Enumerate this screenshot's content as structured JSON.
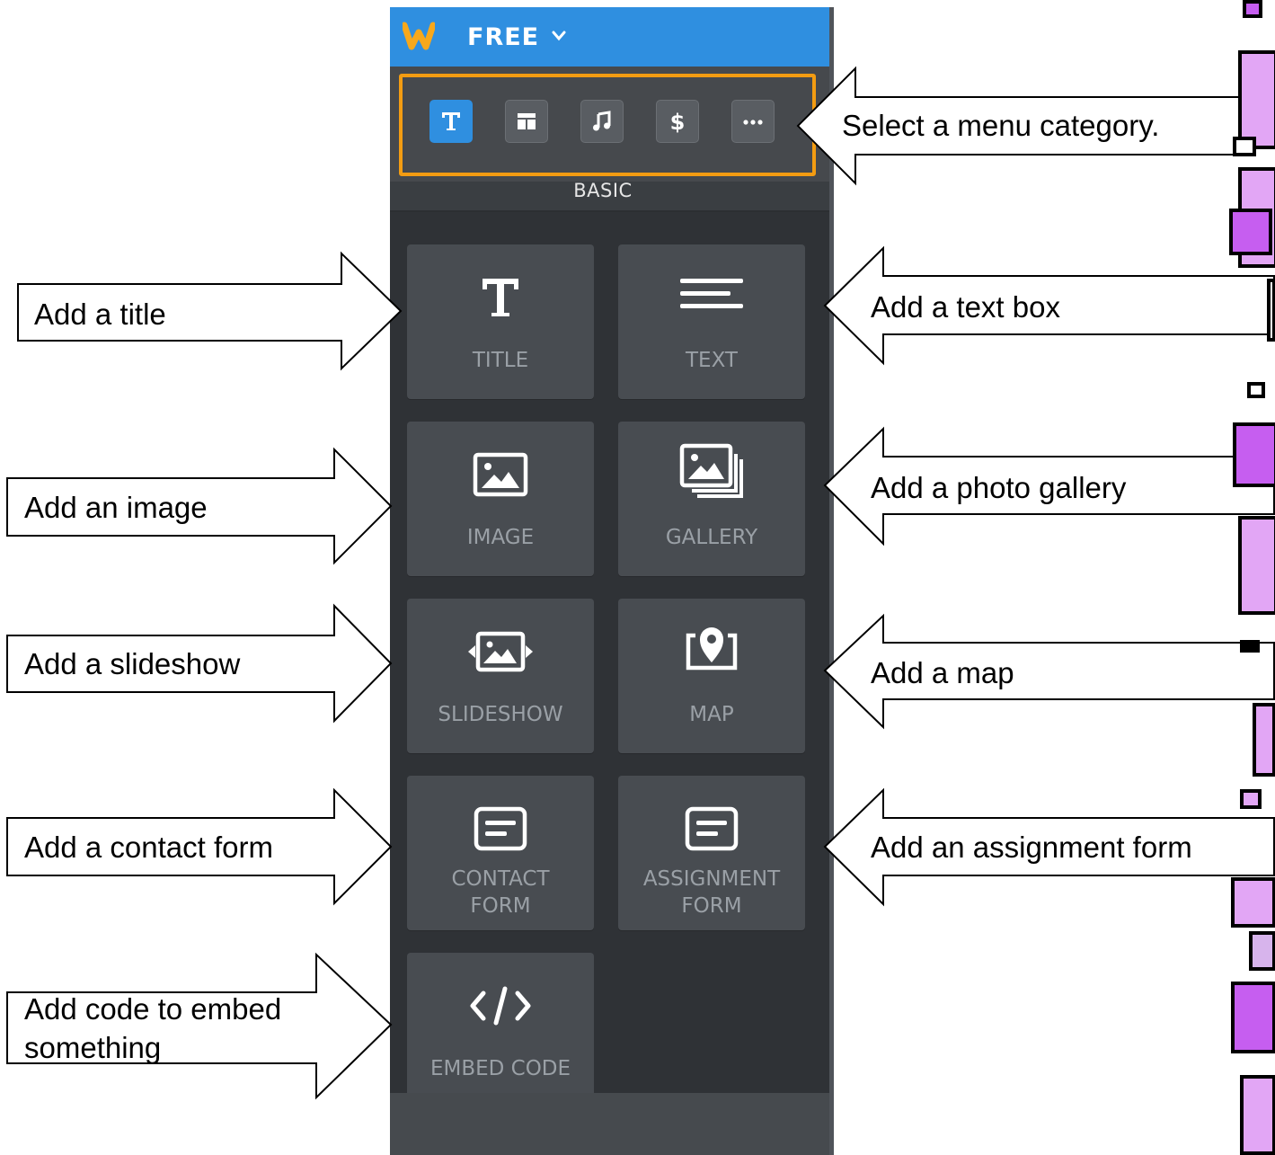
{
  "app": {
    "plan_label": "FREE"
  },
  "category_bar": {
    "buttons": [
      {
        "name": "text-category",
        "icon": "text-T-icon",
        "active": true
      },
      {
        "name": "layout-category",
        "icon": "layout-icon",
        "active": false
      },
      {
        "name": "media-category",
        "icon": "music-note-icon",
        "active": false
      },
      {
        "name": "commerce-category",
        "icon": "dollar-icon",
        "active": false
      },
      {
        "name": "more-category",
        "icon": "more-dots-icon",
        "active": false
      }
    ],
    "active_label": "BASIC",
    "highlight_color": "#f39c12",
    "active_color": "#2f8fe0"
  },
  "elements": {
    "title": "TITLE",
    "text": "TEXT",
    "image": "IMAGE",
    "gallery": "GALLERY",
    "slideshow": "SLIDESHOW",
    "map": "MAP",
    "contact_form": [
      "CONTACT",
      "FORM"
    ],
    "assignment_form": [
      "ASSIGNMENT",
      "FORM"
    ],
    "embed_code": "EMBED CODE"
  },
  "callouts": {
    "menu_category": "Select a menu category.",
    "title": "Add a title",
    "text": "Add a text box",
    "image": "Add an image",
    "gallery": "Add a photo gallery",
    "slideshow": "Add a slideshow",
    "map": "Add a map",
    "contact_form": "Add a contact form",
    "assignment_form": "Add an assignment form",
    "embed_code": [
      "Add code to embed",
      "something"
    ]
  },
  "decor_colors": {
    "light": "#e2a6f5",
    "dark": "#c65ef0",
    "muted": "#d7b4ec"
  }
}
